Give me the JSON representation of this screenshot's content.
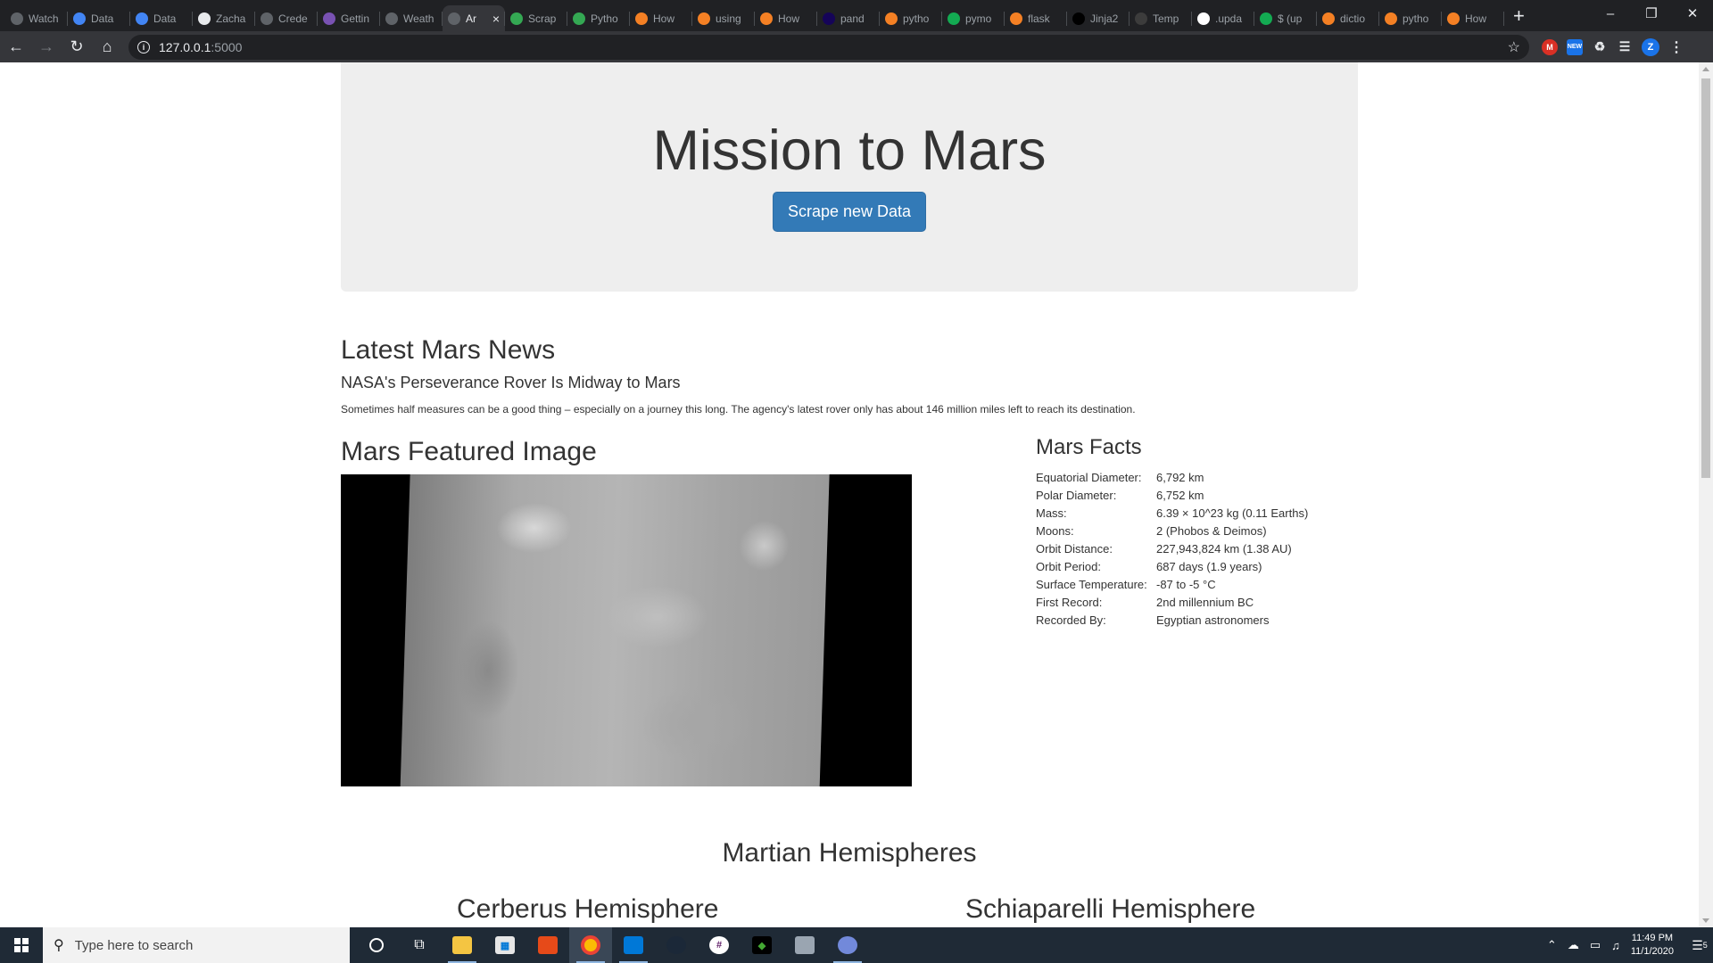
{
  "browser": {
    "tabs": [
      {
        "title": "Watch",
        "color": "#5f6368"
      },
      {
        "title": "Data",
        "color": "#4285f4"
      },
      {
        "title": "Data",
        "color": "#4285f4"
      },
      {
        "title": "Zacha",
        "color": "#e8eaed"
      },
      {
        "title": "Crede",
        "color": "#5f6368"
      },
      {
        "title": "Gettin",
        "color": "#7952b3"
      },
      {
        "title": "Weath",
        "color": "#5f6368"
      },
      {
        "title": "Ar",
        "color": "#5f6368"
      },
      {
        "title": "Scrap",
        "color": "#34a853"
      },
      {
        "title": "Pytho",
        "color": "#34a853"
      },
      {
        "title": "How",
        "color": "#f48024"
      },
      {
        "title": "using",
        "color": "#f48024"
      },
      {
        "title": "How",
        "color": "#f48024"
      },
      {
        "title": "pand",
        "color": "#150458"
      },
      {
        "title": "pytho",
        "color": "#f48024"
      },
      {
        "title": "pymo",
        "color": "#13aa52"
      },
      {
        "title": "flask",
        "color": "#f48024"
      },
      {
        "title": "Jinja2",
        "color": "#000000"
      },
      {
        "title": "Temp",
        "color": "#3c3c3c"
      },
      {
        "title": ".upda",
        "color": "#ffffff"
      },
      {
        "title": "$ (up",
        "color": "#13aa52"
      },
      {
        "title": "dictio",
        "color": "#f48024"
      },
      {
        "title": "pytho",
        "color": "#f48024"
      },
      {
        "title": "How",
        "color": "#f48024"
      }
    ],
    "active_tab_index": 7,
    "url_host": "127.0.0.1",
    "url_port": ":5000",
    "profile_initial": "Z",
    "ext_badge": "NEW"
  },
  "page": {
    "title": "Mission to Mars",
    "scrape_button": "Scrape new Data",
    "news_heading": "Latest Mars News",
    "news_title": "NASA's Perseverance Rover Is Midway to Mars",
    "news_paragraph": "Sometimes half measures can be a good thing – especially on a journey this long. The agency's latest rover only has about 146 million miles left to reach its destination.",
    "featured_heading": "Mars Featured Image",
    "facts_heading": "Mars Facts",
    "facts": [
      {
        "label": "Equatorial Diameter:",
        "value": "6,792 km"
      },
      {
        "label": "Polar Diameter:",
        "value": "6,752 km"
      },
      {
        "label": "Mass:",
        "value": "6.39 × 10^23 kg (0.11 Earths)"
      },
      {
        "label": "Moons:",
        "value": "2 (Phobos & Deimos)"
      },
      {
        "label": "Orbit Distance:",
        "value": "227,943,824 km (1.38 AU)"
      },
      {
        "label": "Orbit Period:",
        "value": "687 days (1.9 years)"
      },
      {
        "label": "Surface Temperature:",
        "value": "-87 to -5 °C"
      },
      {
        "label": "First Record:",
        "value": "2nd millennium BC"
      },
      {
        "label": "Recorded By:",
        "value": "Egyptian astronomers"
      }
    ],
    "hemispheres_heading": "Martian Hemispheres",
    "hemispheres": [
      "Cerberus Hemisphere",
      "Schiaparelli Hemisphere"
    ]
  },
  "taskbar": {
    "search_placeholder": "Type here to search",
    "time": "11:49 PM",
    "date": "11/1/2020",
    "notification_count": "5"
  }
}
